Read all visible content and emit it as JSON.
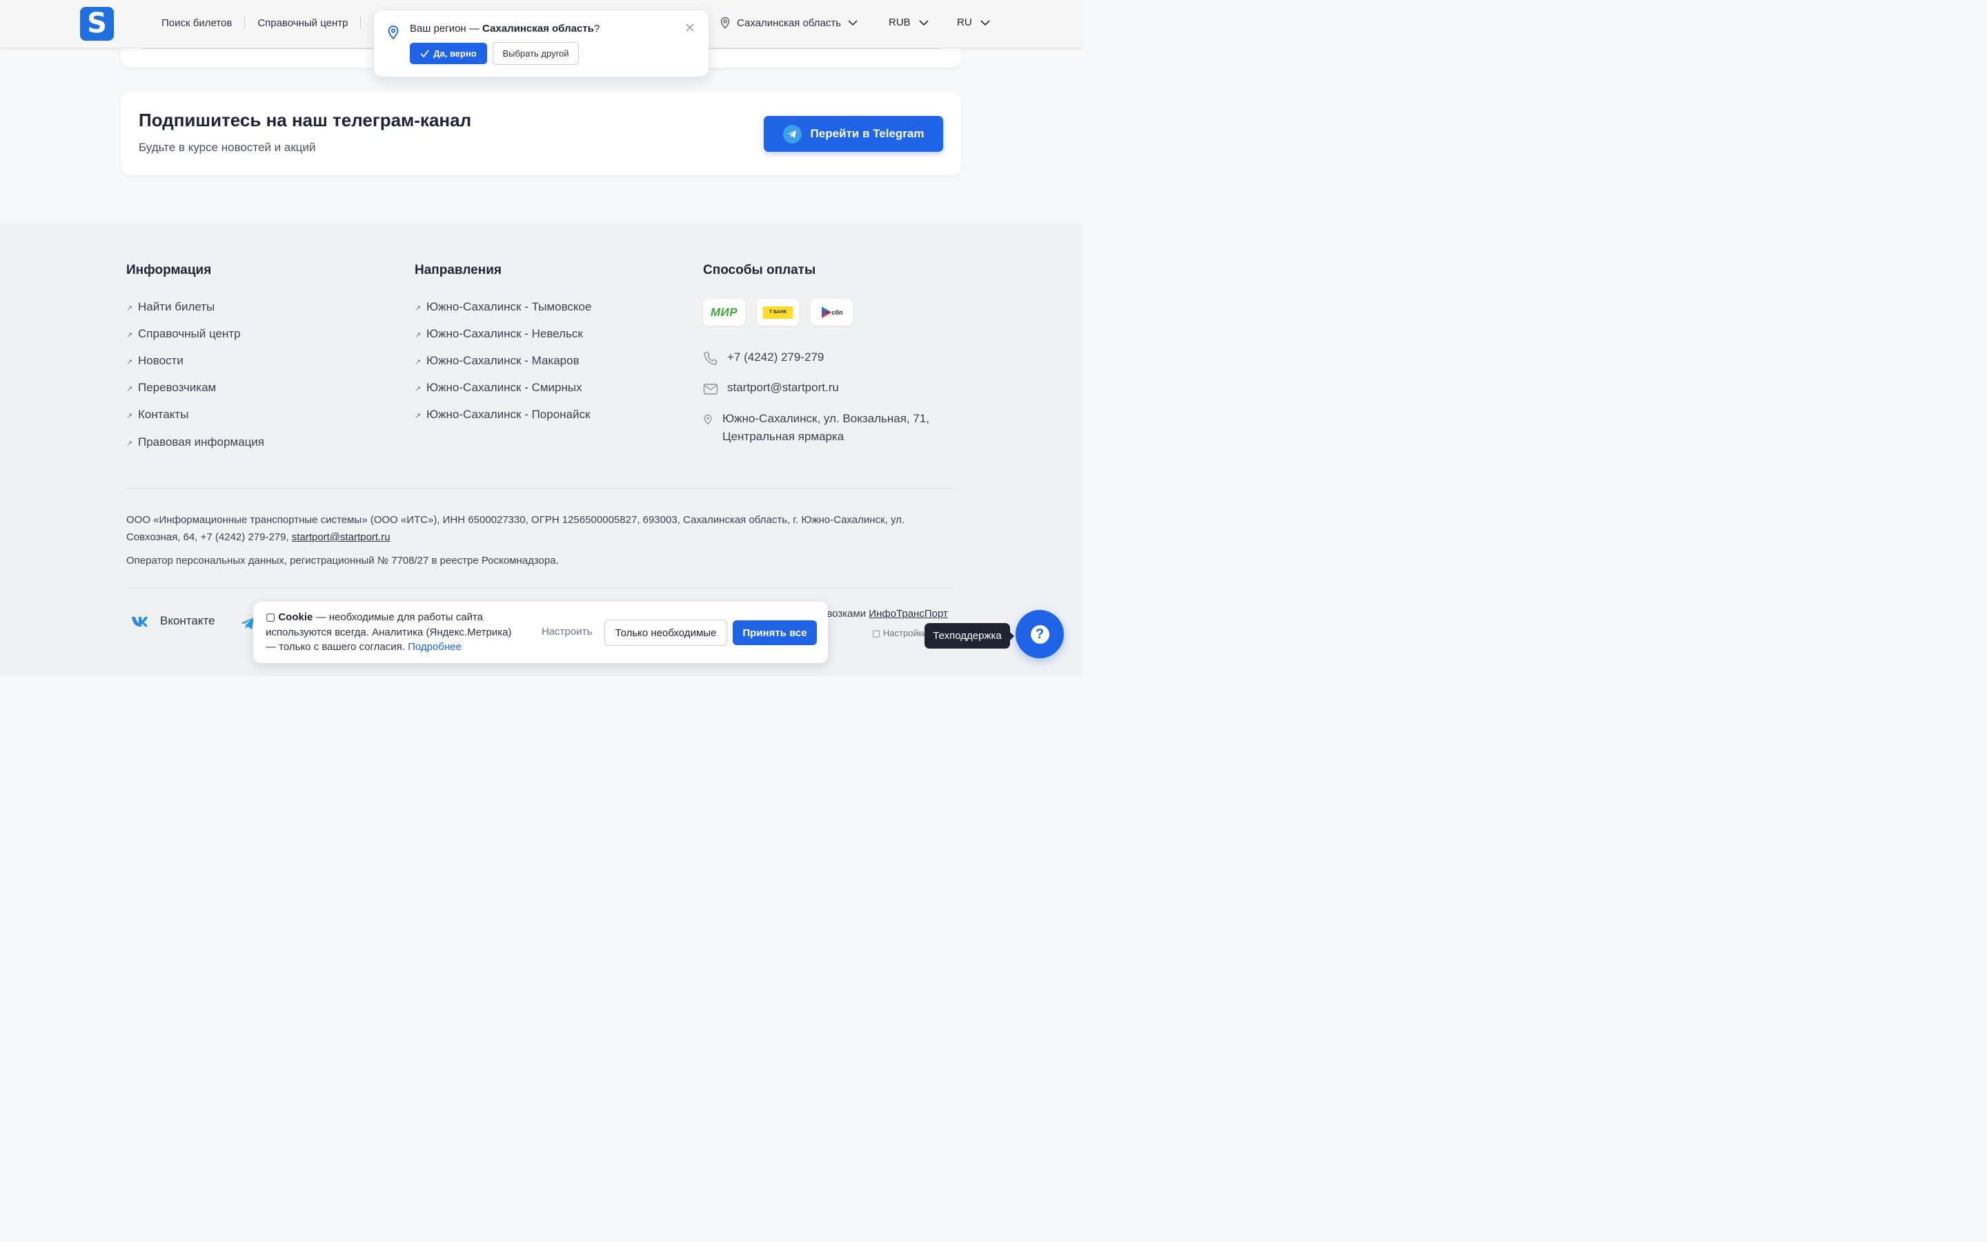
{
  "header": {
    "logo_letter": "S",
    "nav": [
      "Поиск билетов",
      "Справочный центр"
    ],
    "region": "Сахалинская область",
    "currency": "RUB",
    "language": "RU"
  },
  "region_popup": {
    "prefix": "Ваш регион — ",
    "region": "Сахалинская область",
    "suffix": "?",
    "confirm": "Да, верно",
    "choose_other": "Выбрать другой"
  },
  "telegram": {
    "title": "Подпишитесь на наш телеграм-канал",
    "subtitle": "Будьте в курсе новостей и акций",
    "button": "Перейти в Telegram"
  },
  "footer": {
    "info_title": "Информация",
    "info_links": [
      "Найти билеты",
      "Справочный центр",
      "Новости",
      "Перевозчикам",
      "Контакты",
      "Правовая информация"
    ],
    "dir_title": "Направления",
    "dir_links": [
      "Южно-Сахалинск - Тымовское",
      "Южно-Сахалинск - Невельск",
      "Южно-Сахалинск - Макаров",
      "Южно-Сахалинск - Смирных",
      "Южно-Сахалинск - Поронайск"
    ],
    "pay_title": "Способы оплаты",
    "pay_methods": [
      "МИР",
      "Т БАНК",
      "сбп"
    ],
    "phone": "+7 (4242) 279-279",
    "email": "startport@startport.ru",
    "address_line1": "Южно-Сахалинск, ул. Вокзальная, 71,",
    "address_line2": "Центральная ярмарка",
    "legal_text": "ООО «Информационные транспортные системы» (ООО «ИТС»), ИНН 6500027330, ОГРН 1256500005827, 693003, Сахалинская область, г. Южно-Сахалинск, ул. Совхозная, 64, +7 (4242) 279-279, ",
    "legal_email": "startport@startport.ru",
    "operator_text": "Оператор персональных данных, регистрационный № 7708/27 в реестре Роскомнадзора.",
    "social_vk": "Вконтакте",
    "developer_prefix": "евозками ",
    "developer_link": "ИнфоТрансПорт",
    "settings_partial": "Настройки"
  },
  "cookie": {
    "title": "Cookie",
    "text": " — необходимые для работы сайта используются всегда. Аналитика (Яндекс.Метрика) — только с вашего согласия. ",
    "more": "Подробнее",
    "configure": "Настроить",
    "necessary_only": "Только необходимые",
    "accept_all": "Принять все"
  },
  "support": {
    "tooltip": "Техподдержка",
    "icon_glyph": "?"
  },
  "colors": {
    "accent": "#1f63e6",
    "logo": "#1f6fe0",
    "footer_bg": "#f0f1f3",
    "telegram_icon": "#3da0e6",
    "vk": "#2787f5"
  }
}
